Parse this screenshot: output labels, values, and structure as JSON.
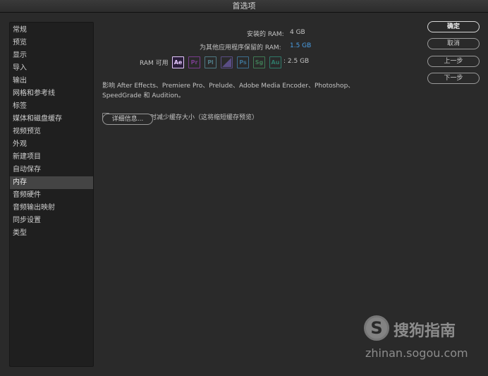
{
  "window": {
    "title": "首选项"
  },
  "sidebar": {
    "items": [
      {
        "label": "常规"
      },
      {
        "label": "预览"
      },
      {
        "label": "显示"
      },
      {
        "label": "导入"
      },
      {
        "label": "输出"
      },
      {
        "label": "网格和参考线"
      },
      {
        "label": "标签"
      },
      {
        "label": "媒体和磁盘缓存"
      },
      {
        "label": "视频预览"
      },
      {
        "label": "外观"
      },
      {
        "label": "新建项目"
      },
      {
        "label": "自动保存"
      },
      {
        "label": "内存"
      },
      {
        "label": "音频硬件"
      },
      {
        "label": "音频输出映射"
      },
      {
        "label": "同步设置"
      },
      {
        "label": "类型"
      }
    ],
    "active_label": "内存"
  },
  "memory": {
    "installed_label": "安装的 RAM:",
    "installed_value": "4 GB",
    "reserved_label": "为其他应用程序保留的 RAM:",
    "reserved_value": "1.5 GB",
    "available_label": "RAM 可用",
    "available_value": ": 2.5 GB",
    "apps": [
      {
        "abbr": "Ae",
        "color": "#d9b6ff",
        "active": true
      },
      {
        "abbr": "Pr",
        "color": "#7a3d8f"
      },
      {
        "abbr": "Pl",
        "color": "#4f7a84"
      },
      {
        "abbr": "Sg",
        "color": "#5a4d85",
        "shape": "diagonal"
      },
      {
        "abbr": "Ps",
        "color": "#3d6f8f"
      },
      {
        "abbr": "Sg",
        "color": "#3f7a55"
      },
      {
        "abbr": "Au",
        "color": "#2f7a6a"
      }
    ],
    "affects_line1": "影响 After Effects、Premiere Pro、Prelude、Adobe Media Encoder、Photoshop、",
    "affects_line2": "SpeedGrade 和 Audition。",
    "reduce_cache_label": "系统内存不足时减少缓存大小（这将缩短缓存预览）",
    "details_button": "详细信息..."
  },
  "buttons": {
    "ok": "确定",
    "cancel": "取消",
    "previous": "上一步",
    "next": "下一步"
  },
  "watermark": {
    "logo_letter": "S",
    "title": "搜狗指南",
    "url": "zhinan.sogou.com"
  }
}
